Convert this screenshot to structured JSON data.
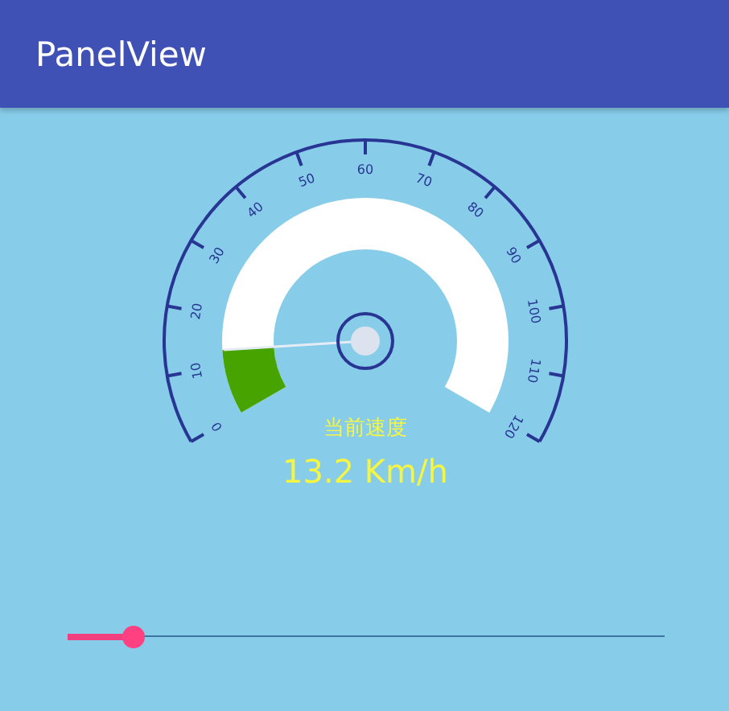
{
  "app_bar": {
    "title": "PanelView"
  },
  "gauge": {
    "tick_labels": [
      "0",
      "10",
      "20",
      "30",
      "40",
      "50",
      "60",
      "70",
      "80",
      "90",
      "100",
      "110",
      "120"
    ],
    "caption": "当前速度",
    "reading": "13.2 Km/h"
  },
  "slider": {
    "level": 0.11
  }
}
